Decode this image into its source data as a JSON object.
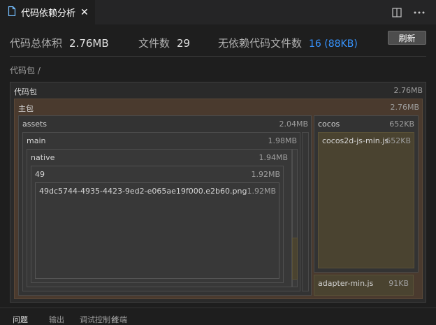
{
  "tab": {
    "title": "代码依赖分析",
    "close": "✕",
    "icon": "file-icon"
  },
  "toolbar": {
    "split_icon": "split-editor-icon",
    "more_icon": "more-icon"
  },
  "stats": {
    "total_label": "代码总体积",
    "total_value": "2.76MB",
    "files_label": "文件数",
    "files_value": "29",
    "nodep_label": "无依赖代码文件数",
    "nodep_value": "16 (88KB)",
    "accent": "#3794ff"
  },
  "refresh_label": "刷新",
  "breadcrumb": "代码包 /",
  "treemap": {
    "root": {
      "label": "代码包",
      "size": "2.76MB"
    },
    "main_package": {
      "label": "主包",
      "size": "2.76MB"
    },
    "assets": {
      "label": "assets",
      "size": "2.04MB"
    },
    "main": {
      "label": "main",
      "size": "1.98MB"
    },
    "native": {
      "label": "native",
      "size": "1.94MB"
    },
    "dir49": {
      "label": "49",
      "size": "1.92MB"
    },
    "png": {
      "label": "49dc5744-4935-4423-9ed2-e065ae19f000.e2b60.png",
      "size": "1.92MB"
    },
    "cocos": {
      "label": "cocos",
      "size": "652KB"
    },
    "cocos_js": {
      "label": "cocos2d-js-min.js",
      "size": "652KB"
    },
    "adapter": {
      "label": "adapter-min.js",
      "size": "91KB"
    },
    "colors": {
      "main_package": "#4a3a2e",
      "file": "#4a4330",
      "dir": "#383838"
    }
  },
  "bottom_tabs": [
    "问题",
    "输出",
    "调试控制台",
    "终端"
  ]
}
